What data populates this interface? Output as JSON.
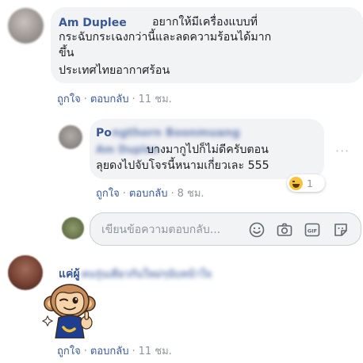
{
  "comment1": {
    "name": "Am Duplee",
    "text_lines": [
      "อยากให้มีเครื่องแบบที่",
      "กระฉับกระเฉงกว่านี้และลดความร้อนได้มาก",
      "ขึ้น",
      "ประเทศไทยอากาศร้อน"
    ],
    "like": "ถูกใจ",
    "reply": "ตอบกลับ",
    "time": "11 ชม."
  },
  "reply1": {
    "name_visible": "Po",
    "name_blurred": "ngthorn Boonmuang",
    "name_blurred_2": "Am Duplee",
    "text_lines": [
      "บางมากูไปก็ไม่ดีครับตอน",
      "ลุยดงไปจับโจรนี้หนามเกี่ยวเละ 555"
    ],
    "like": "ถูกใจ",
    "reply": "ตอบกลับ",
    "time": "8 ชม.",
    "reaction_count": "1",
    "more": "···"
  },
  "reply_box": {
    "placeholder": "เขียนข้อความตอบกลับ...",
    "icons": [
      "emoji-icon",
      "camera-icon",
      "gif-icon",
      "sticker-icon"
    ]
  },
  "comment2": {
    "name": "แค่ผู้",
    "name_blurred": "คนรุ่นเดียวกันใหม่ๆนับหน้าใจ",
    "like": "ถูกใจ",
    "reply": "ตอบกลับ",
    "time": "11 ชม."
  },
  "colors": {
    "link": "#385898",
    "bubble": "#f2f3f5",
    "meta_gray": "#90949c"
  }
}
